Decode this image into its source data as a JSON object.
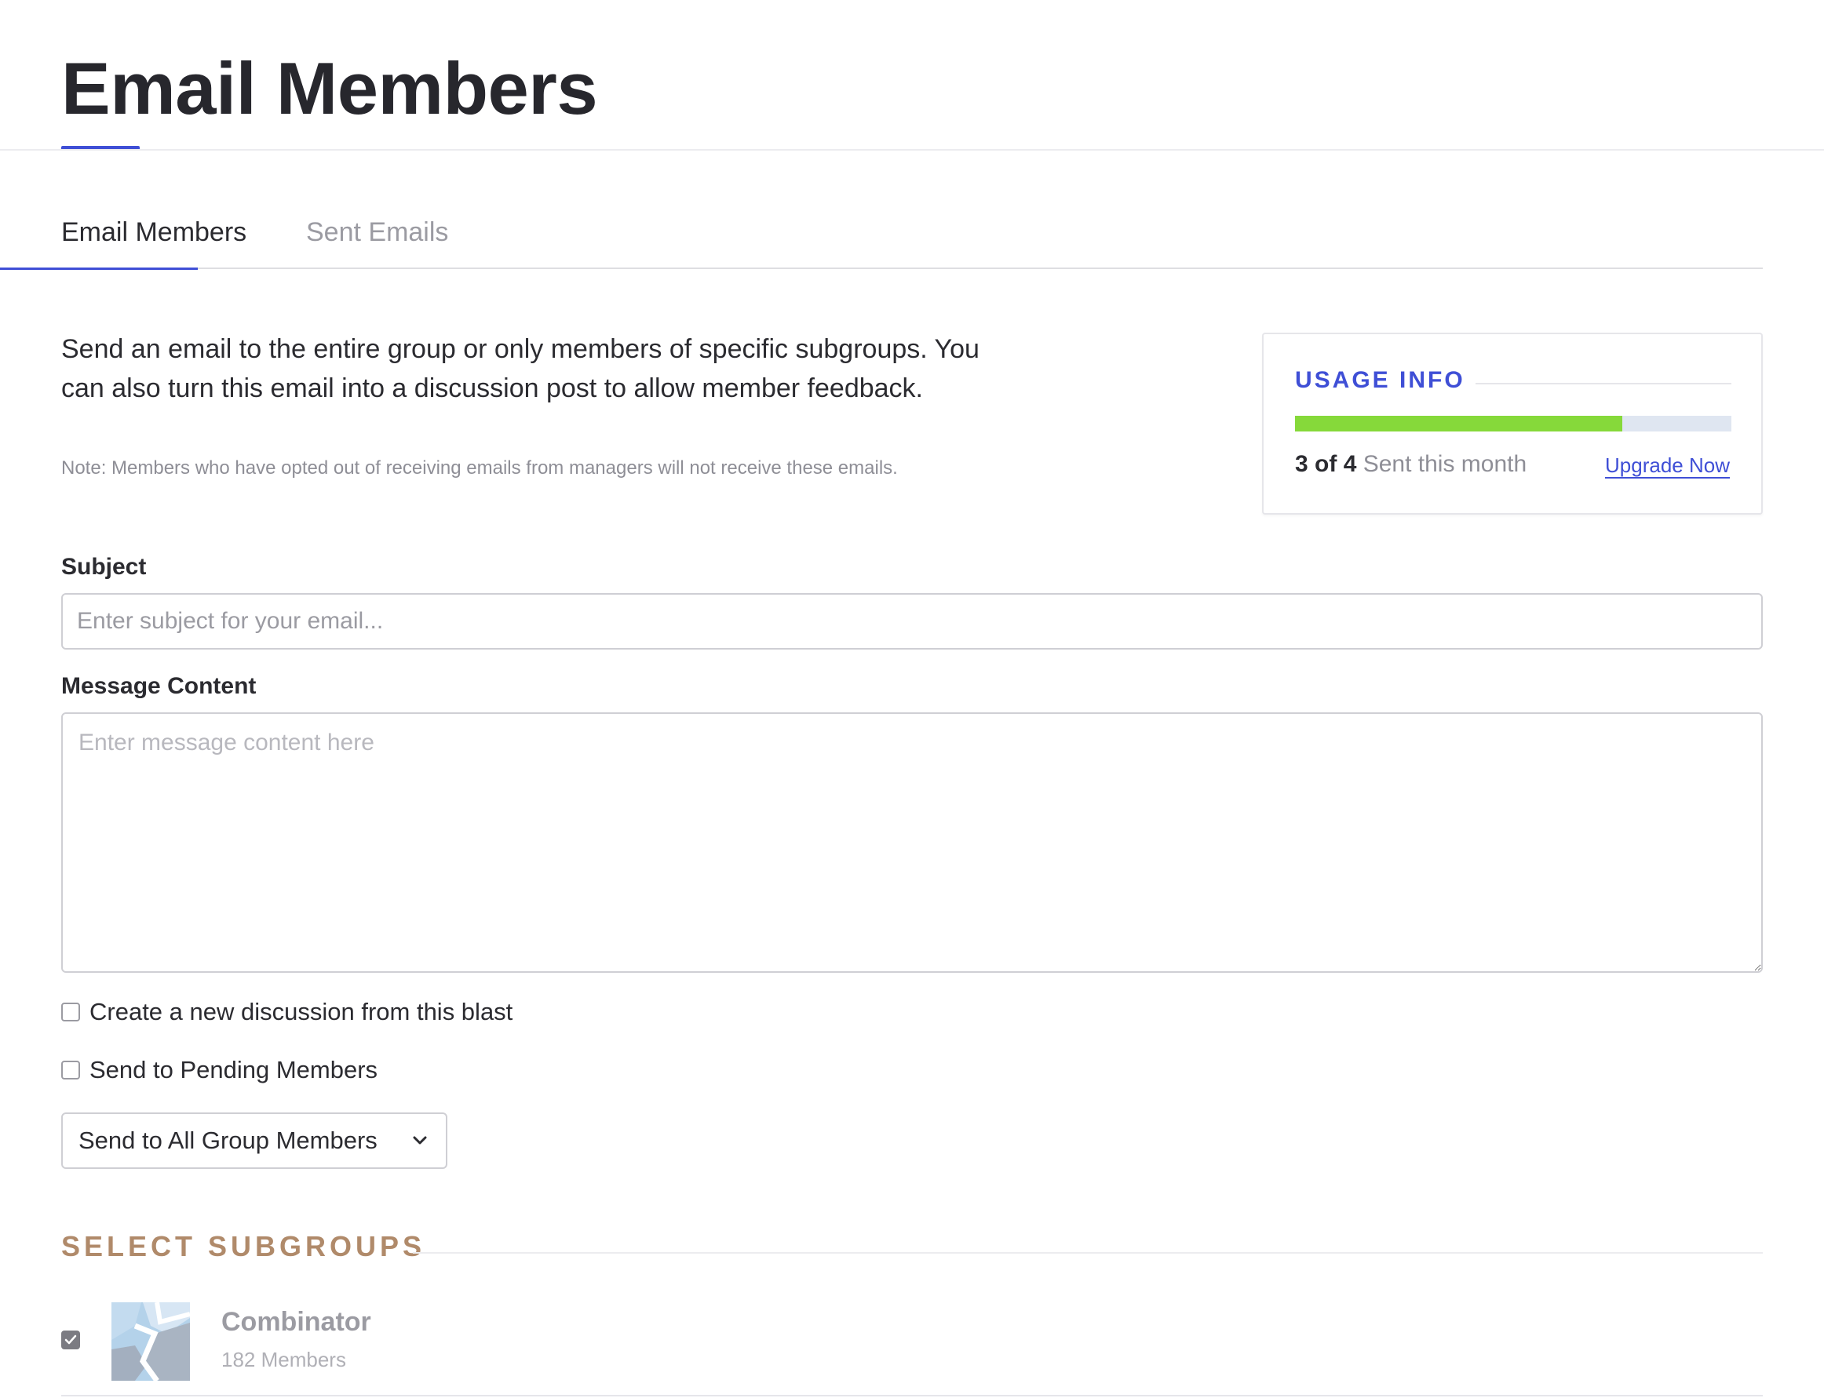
{
  "page": {
    "title": "Email Members"
  },
  "tabs": [
    {
      "label": "Email Members",
      "active": true
    },
    {
      "label": "Sent Emails",
      "active": false
    }
  ],
  "intro": {
    "description": "Send an email to the entire group or only members of specific subgroups. You can also turn this email into a discussion post to allow member feedback.",
    "note": "Note: Members who have opted out of receiving emails from managers will not receive these emails."
  },
  "usage": {
    "title": "USAGE INFO",
    "used": "3",
    "of_label": "of",
    "limit": "4",
    "period_label": "Sent this month",
    "progress_fraction": 0.75,
    "upgrade_label": "Upgrade Now",
    "bar_color": "#86d93a",
    "bar_track_color": "#dfe6f1"
  },
  "form": {
    "subject_label": "Subject",
    "subject_placeholder": "Enter subject for your email...",
    "subject_value": "",
    "message_label": "Message Content",
    "message_placeholder": "Enter message content here",
    "message_value": "",
    "checkboxes": [
      {
        "label": "Create a new discussion from this blast",
        "checked": false
      },
      {
        "label": "Send to Pending Members",
        "checked": false
      }
    ],
    "recipient_select": {
      "selected": "Send to All Group Members",
      "icon": "chevron-down-icon"
    }
  },
  "subgroups": {
    "heading": "SELECT SUBGROUPS",
    "items": [
      {
        "name": "Combinator",
        "members": "182 Members",
        "checked": true
      }
    ]
  },
  "colors": {
    "accent": "#3f4fd6",
    "heading_brown": "#b08a6a",
    "text": "#2b2b30",
    "muted": "#8e8e96"
  }
}
